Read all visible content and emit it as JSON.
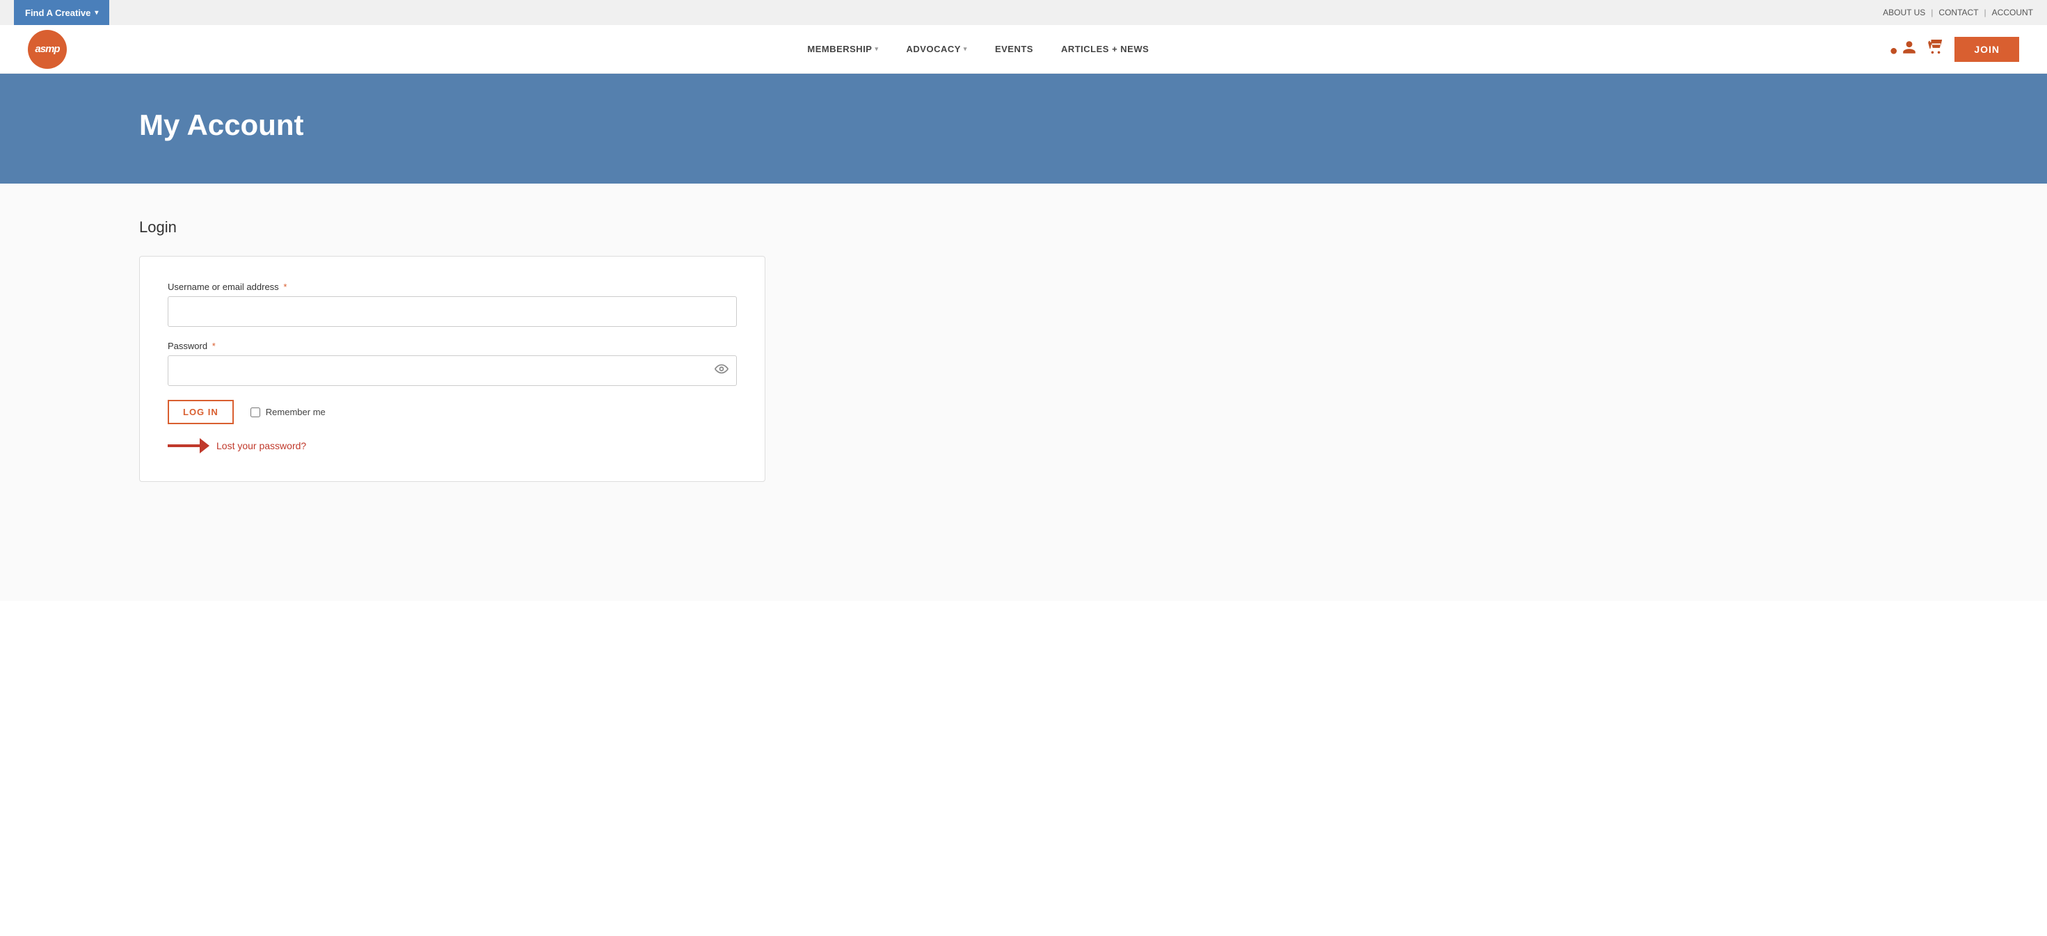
{
  "topbar": {
    "find_creative_label": "Find A Creative",
    "about_label": "ABOUT US",
    "contact_label": "CONTACT",
    "account_label": "ACCOUNT"
  },
  "nav": {
    "logo_text": "asmp",
    "links": [
      {
        "label": "MEMBERSHIP",
        "has_dropdown": true
      },
      {
        "label": "ADVOCACY",
        "has_dropdown": true
      },
      {
        "label": "EVENTS",
        "has_dropdown": false
      },
      {
        "label": "ARTICLES + NEWS",
        "has_dropdown": false
      }
    ],
    "join_label": "JOIN"
  },
  "hero": {
    "title": "My Account"
  },
  "login": {
    "section_title": "Login",
    "username_label": "Username or email address",
    "username_placeholder": "",
    "password_label": "Password",
    "password_placeholder": "",
    "login_button": "LOG IN",
    "remember_label": "Remember me",
    "lost_password_link": "Lost your password?"
  }
}
